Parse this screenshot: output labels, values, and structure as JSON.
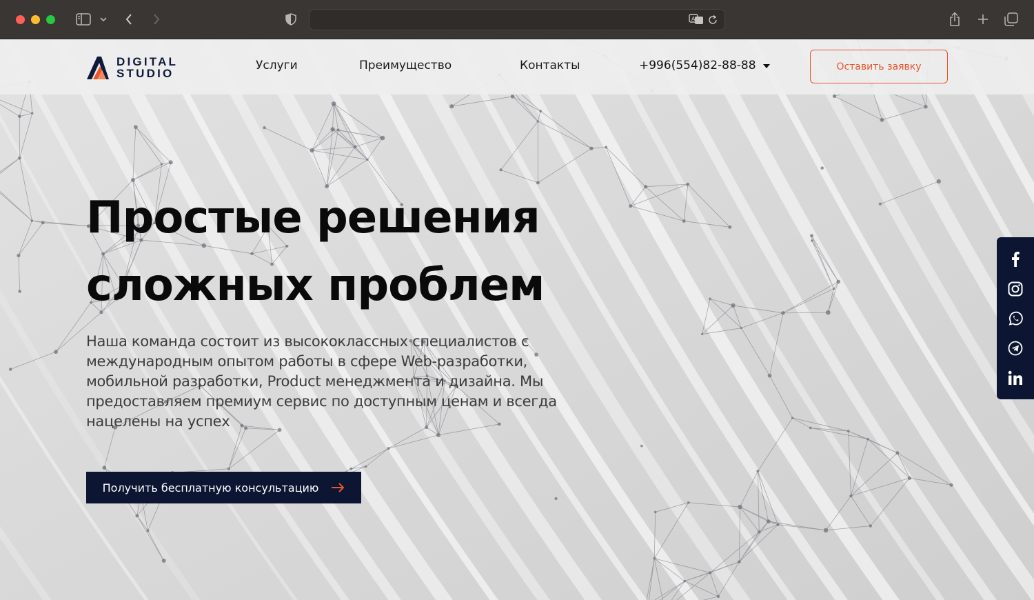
{
  "browser": {
    "url": "",
    "icons": [
      "sidebar-icon",
      "chevron-down-icon",
      "back-icon",
      "forward-icon",
      "shield-icon",
      "translate-icon",
      "reload-icon",
      "share-icon",
      "new-tab-icon",
      "tabs-icon"
    ]
  },
  "header": {
    "logo_line1": "DIGITAL",
    "logo_line2": "STUDIO",
    "nav": [
      "Услуги",
      "Преимущество",
      "Контакты"
    ],
    "phone": "+996(554)82-88-88",
    "cta_label": "Оставить заявку"
  },
  "hero": {
    "title_line1": "Простые решения",
    "title_line2_plain": "сложных",
    "title_line2_highlight": "проблем",
    "description": "Наша команда состоит из высококлассных специалистов с международным опытом работы в сфере Web-разработки, мобильной разработки, Product менеджмента и дизайна. Мы предоставляем премиум сервис по доступным ценам и всегда нацелены на успех",
    "button_label": "Получить бесплатную консультацию"
  },
  "social": [
    "facebook-icon",
    "instagram-icon",
    "whatsapp-icon",
    "telegram-icon",
    "linkedin-icon"
  ],
  "colors": {
    "accent": "#e8552f",
    "navy": "#0c1633"
  }
}
